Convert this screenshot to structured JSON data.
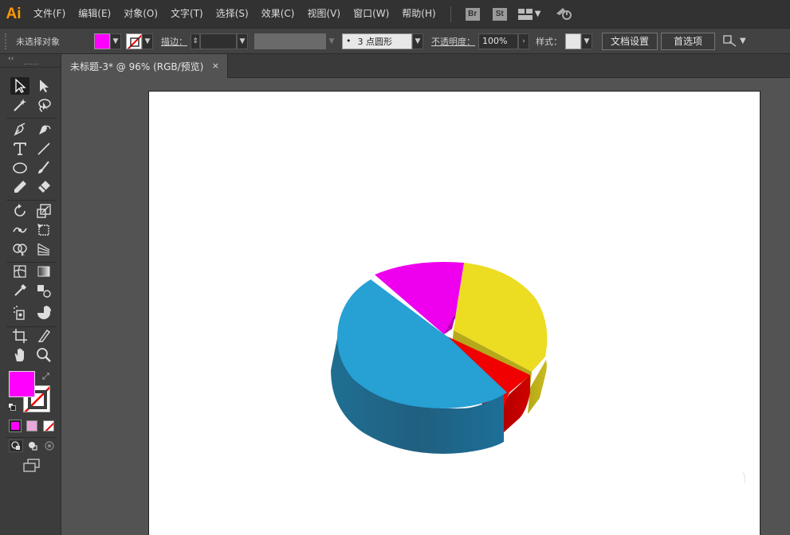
{
  "app": {
    "logo": "Ai"
  },
  "menu": {
    "items": [
      "文件(F)",
      "编辑(E)",
      "对象(O)",
      "文字(T)",
      "选择(S)",
      "效果(C)",
      "视图(V)",
      "窗口(W)",
      "帮助(H)"
    ],
    "bridge": "Br",
    "stock": "St"
  },
  "control": {
    "selection_status": "未选择对象",
    "stroke_label": "描边：",
    "brush_value": "3 点圆形",
    "opacity_label": "不透明度：",
    "opacity_value": "100%",
    "style_label": "样式：",
    "doc_setup_label": "文档设置",
    "prefs_label": "首选项",
    "fill_color": "#ff00ff"
  },
  "tab": {
    "title": "未标题-3* @ 96% (RGB/预览)",
    "close": "×"
  },
  "tools": {
    "fill_color": "#ff00ff",
    "stroke_color": "#ffffff"
  },
  "chart": {
    "type": "3d-pie",
    "slice_colors": [
      "#27a0d4",
      "#ee00ee",
      "#ecdc22",
      "#f00000"
    ]
  }
}
